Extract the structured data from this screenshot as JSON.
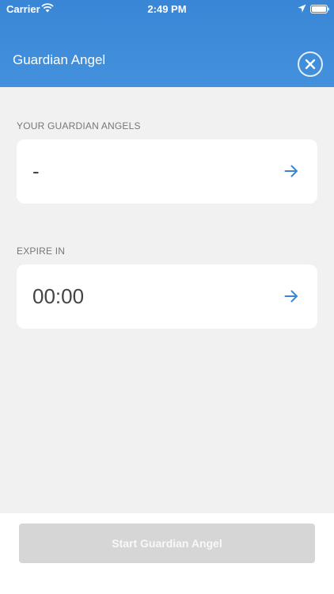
{
  "status_bar": {
    "carrier": "Carrier",
    "time": "2:49 PM",
    "icons": [
      "wifi-icon",
      "location-arrow-icon",
      "battery-icon"
    ]
  },
  "header": {
    "title": "Guardian Angel",
    "close_icon": "close-circle-icon",
    "background_color": "#3a86d6"
  },
  "guardians": {
    "label": "YOUR GUARDIAN ANGELS",
    "value": "-",
    "arrow_icon": "arrow-right-icon"
  },
  "expire": {
    "label": "EXPIRE IN",
    "value": "00:00",
    "arrow_icon": "arrow-right-icon"
  },
  "footer": {
    "start_label": "Start Guardian Angel",
    "button_state": "disabled"
  },
  "colors": {
    "accent": "#3a86d6",
    "background": "#f1f1f1",
    "disabled_button": "#d6d6d6"
  }
}
